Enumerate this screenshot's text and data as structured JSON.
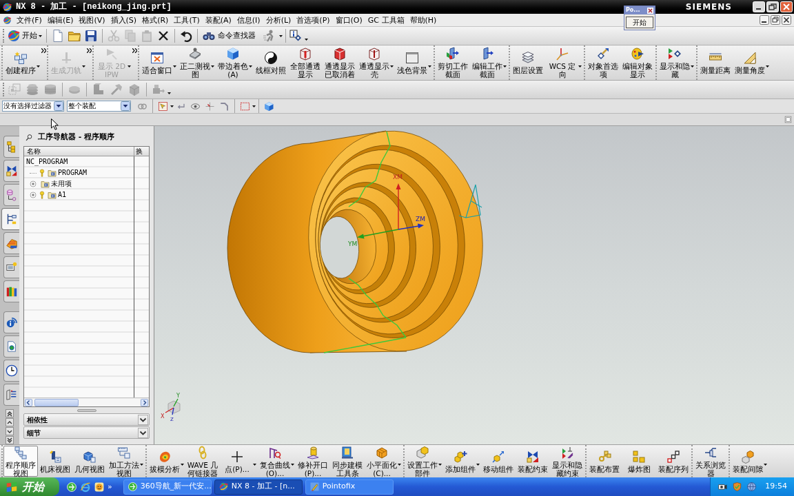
{
  "title_bar": {
    "title": "NX 8 - 加工 - [neikong_jing.prt]",
    "brand": "SIEMENS"
  },
  "floating_window": {
    "title": "Po...",
    "button": "开始"
  },
  "menu_bar": {
    "items": [
      "文件(F)",
      "编辑(E)",
      "视图(V)",
      "插入(S)",
      "格式(R)",
      "工具(T)",
      "装配(A)",
      "信息(I)",
      "分析(L)",
      "首选项(P)",
      "窗口(O)",
      "GC 工具箱",
      "帮助(H)"
    ]
  },
  "standard_toolbar": {
    "start": "开始",
    "tools": [
      {
        "disabled": false
      },
      {
        "disabled": false
      },
      {
        "disabled": false
      },
      {
        "disabled": true
      },
      {
        "disabled": true
      },
      {
        "disabled": true
      },
      {
        "disabled": false
      },
      {
        "disabled": false
      }
    ],
    "command_finder": "命令查找器"
  },
  "main_toolbar": {
    "groups": [
      {
        "overflow": true,
        "items": [
          {
            "label": "创建程序",
            "disabled": false,
            "dropdown": true
          }
        ]
      },
      {
        "overflow": true,
        "items": [
          {
            "label": "生成刀轨",
            "disabled": true,
            "dropdown": true
          }
        ]
      },
      {
        "overflow": true,
        "items": [
          {
            "label": "显示 2D IPW",
            "disabled": true,
            "dropdown": true
          }
        ]
      },
      {
        "overflow": false,
        "items": [
          {
            "label": "适合窗口",
            "disabled": false,
            "dropdown": true
          },
          {
            "label": "正二测视图",
            "disabled": false,
            "dropdown": true
          },
          {
            "label": "带边着色(A)",
            "disabled": false,
            "dropdown": true
          },
          {
            "label": "线框对照",
            "disabled": false,
            "dropdown": false
          },
          {
            "label": "全部通透显示",
            "disabled": false,
            "dropdown": false
          },
          {
            "label": "通透显示已取消着",
            "disabled": false,
            "dropdown": false
          },
          {
            "label": "通透显示壳",
            "disabled": false,
            "dropdown": true
          },
          {
            "label": "浅色背景",
            "disabled": false,
            "dropdown": true
          }
        ]
      },
      {
        "overflow": false,
        "items": [
          {
            "label": "剪切工作截面",
            "disabled": false,
            "dropdown": false
          },
          {
            "label": "编辑工作截面",
            "disabled": false,
            "dropdown": true
          }
        ]
      },
      {
        "overflow": false,
        "items": [
          {
            "label": "图层设置",
            "disabled": false,
            "dropdown": false
          },
          {
            "label": "WCS 定向",
            "disabled": false,
            "dropdown": true
          }
        ]
      },
      {
        "overflow": false,
        "items": [
          {
            "label": "对象首选项",
            "disabled": false,
            "dropdown": false
          },
          {
            "label": "编辑对象显示",
            "disabled": false,
            "dropdown": false
          }
        ]
      },
      {
        "overflow": false,
        "items": [
          {
            "label": "显示和隐藏",
            "disabled": false,
            "dropdown": true
          }
        ]
      },
      {
        "overflow": false,
        "items": [
          {
            "label": "测量距离",
            "disabled": false,
            "dropdown": false
          },
          {
            "label": "测量角度",
            "disabled": false,
            "dropdown": true
          }
        ]
      }
    ]
  },
  "icon_toolbar": {
    "tools": [
      {
        "disabled": true
      },
      {
        "disabled": true
      },
      {
        "disabled": true
      },
      {
        "disabled": true
      },
      {
        "disabled": true
      },
      {
        "disabled": true
      },
      {
        "disabled": true
      },
      {
        "disabled": true
      }
    ]
  },
  "selection_bar": {
    "type_filter": "没有选择过滤器",
    "scope": "整个装配"
  },
  "resource_bar": {
    "tabs": [
      {
        "selected": false
      },
      {
        "selected": false
      },
      {
        "selected": false
      },
      {
        "selected": true
      },
      {
        "selected": false
      },
      {
        "selected": false
      },
      {
        "selected": false
      },
      {
        "selected": false
      },
      {
        "selected": false
      },
      {
        "selected": false
      },
      {
        "selected": false
      }
    ]
  },
  "navigator": {
    "title": "工序导航器 - 程序顺序",
    "columns": [
      "名称",
      "换"
    ],
    "tree": [
      {
        "name": "NC_PROGRAM",
        "expander": false,
        "flagged": false,
        "children": [
          {
            "name": "PROGRAM",
            "expander": false,
            "flagged": true
          },
          {
            "name": "未用项",
            "expander": true,
            "flagged": false
          },
          {
            "name": "A1",
            "expander": true,
            "flagged": true
          }
        ]
      }
    ],
    "panels": [
      {
        "title": "相依性",
        "expanded": false
      },
      {
        "title": "细节",
        "expanded": false
      }
    ]
  },
  "viewport": {
    "wcs_labels": [
      "XM",
      "ZM",
      "YM"
    ],
    "view_triad_labels": [
      "Y",
      "X",
      "Z"
    ]
  },
  "bottom_toolbar": {
    "groups": [
      {
        "overflow": false,
        "items": [
          {
            "label": "程序顺序视图",
            "selected": true,
            "dropdown": false
          },
          {
            "label": "机床视图",
            "selected": false,
            "dropdown": false
          },
          {
            "label": "几何视图",
            "selected": false,
            "dropdown": false
          },
          {
            "label": "加工方法视图",
            "selected": false,
            "dropdown": true
          }
        ]
      },
      {
        "overflow": false,
        "items": [
          {
            "label": "拔模分析",
            "dropdown": true
          },
          {
            "label": "WAVE 几何链接器",
            "dropdown": false
          },
          {
            "label": "点(P)...",
            "dropdown": true
          },
          {
            "label": "复合曲线(O)...",
            "dropdown": true
          },
          {
            "label": "修补开口(P)...",
            "dropdown": false
          },
          {
            "label": "同步建模工具条",
            "dropdown": false
          },
          {
            "label": "小平面化(C)...",
            "dropdown": true
          }
        ]
      },
      {
        "overflow": false,
        "items": [
          {
            "label": "设置工作部件",
            "dropdown": true
          },
          {
            "label": "添加组件",
            "dropdown": true
          },
          {
            "label": "移动组件",
            "dropdown": false
          },
          {
            "label": "装配约束",
            "dropdown": false
          },
          {
            "label": "显示和隐藏约束",
            "dropdown": false
          }
        ]
      },
      {
        "overflow": false,
        "items": [
          {
            "label": "装配布置",
            "dropdown": false
          },
          {
            "label": "爆炸图",
            "dropdown": false
          },
          {
            "label": "装配序列",
            "dropdown": false
          }
        ]
      },
      {
        "overflow": false,
        "items": [
          {
            "label": "关系浏览器",
            "dropdown": false
          }
        ]
      },
      {
        "overflow": false,
        "items": [
          {
            "label": "装配间隙",
            "dropdown": true
          }
        ]
      }
    ]
  },
  "taskbar": {
    "start": "开始",
    "more": "»",
    "tasks": [
      {
        "label": "360导航_新一代安...",
        "selected": false
      },
      {
        "label": "NX 8 - 加工 - [n...",
        "selected": true
      },
      {
        "label": "Pointofix",
        "selected": false
      }
    ],
    "clock": "19:54"
  }
}
